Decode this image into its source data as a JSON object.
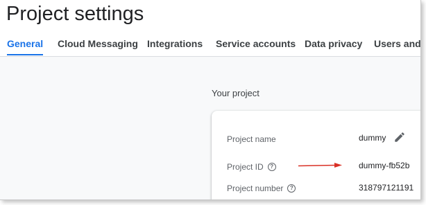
{
  "page": {
    "title": "Project settings"
  },
  "tabs": [
    {
      "label": "General",
      "active": true
    },
    {
      "label": "Cloud Messaging"
    },
    {
      "label": "Integrations"
    },
    {
      "label": "Service accounts"
    },
    {
      "label": "Data privacy"
    },
    {
      "label": "Users and p"
    }
  ],
  "section": {
    "title": "Your project"
  },
  "project": {
    "name_label": "Project name",
    "name_value": "dummy",
    "id_label": "Project ID",
    "id_value": "dummy-fb52b",
    "number_label": "Project number",
    "number_value": "318797121191"
  },
  "icons": {
    "edit": "pencil-icon",
    "help": "help-circle-icon",
    "annotation": "red-arrow"
  },
  "colors": {
    "accent": "#1a73e8",
    "annotation": "#d93025"
  }
}
